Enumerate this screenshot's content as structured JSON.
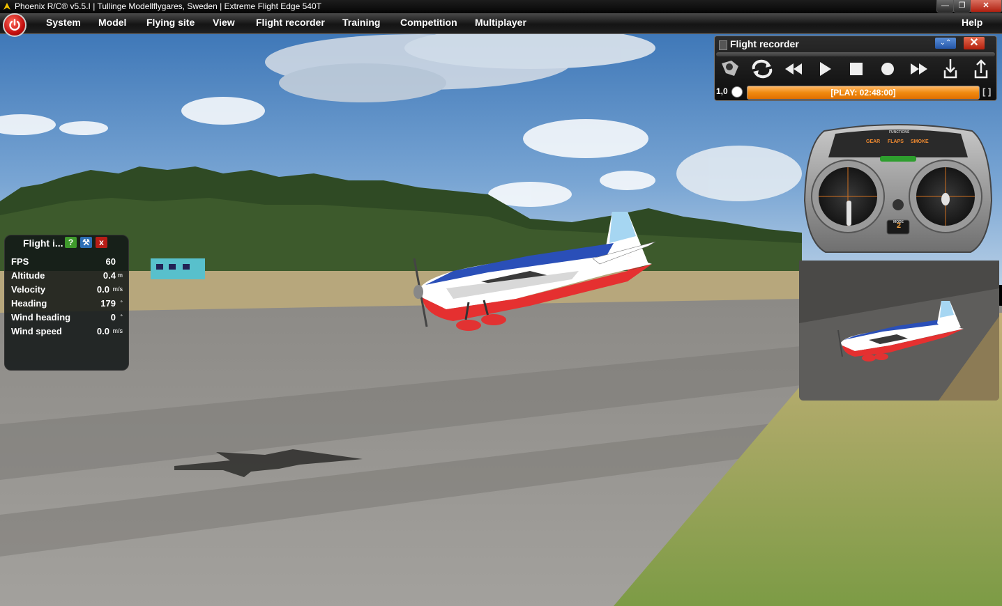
{
  "window": {
    "title": "Phoenix R/C® v5.5.I  |  Tullinge Modellflygares, Sweden  |  Extreme Flight Edge 540T",
    "minimize": "—",
    "maximize": "❐",
    "close": "✕"
  },
  "menu": {
    "items": [
      "System",
      "Model",
      "Flying site",
      "View",
      "Flight recorder",
      "Training",
      "Competition",
      "Multiplayer"
    ],
    "help": "Help"
  },
  "flight_info": {
    "title": "Flight i...",
    "help_btn": "?",
    "tools_btn": "⚒",
    "close_btn": "x",
    "rows": [
      {
        "label": "FPS",
        "value": "60",
        "unit": ""
      },
      {
        "label": "Altitude",
        "value": "0.4",
        "unit": "m"
      },
      {
        "label": "Velocity",
        "value": "0.0",
        "unit": "m/s"
      },
      {
        "label": "Heading",
        "value": "179",
        "unit": "°"
      },
      {
        "label": "Wind heading",
        "value": "0",
        "unit": "°"
      },
      {
        "label": "Wind speed",
        "value": "0.0",
        "unit": "m/s"
      }
    ]
  },
  "recorder": {
    "title": "Flight recorder",
    "collapse": "⌄⌃",
    "close": "✕",
    "speed": "1,0",
    "progress_text": "[PLAY: 02:48:00]",
    "progress": 1.0,
    "loop": "[ ]",
    "buttons": [
      "camera-icon",
      "loop-icon",
      "rewind-icon",
      "play-icon",
      "stop-icon",
      "record-icon",
      "fast-forward-icon",
      "import-icon",
      "export-icon"
    ]
  },
  "transmitter": {
    "functions": "FUNCTIONS",
    "gear": "GEAR",
    "flaps": "FLAPS",
    "smoke": "SMOKE",
    "mode_label": "MODE",
    "mode": "2"
  },
  "colors": {
    "menu_bg": "#1a1a1a",
    "accent_orange": "#f08a10",
    "sky": "#5c8fc4",
    "grass": "#8ba24e"
  }
}
